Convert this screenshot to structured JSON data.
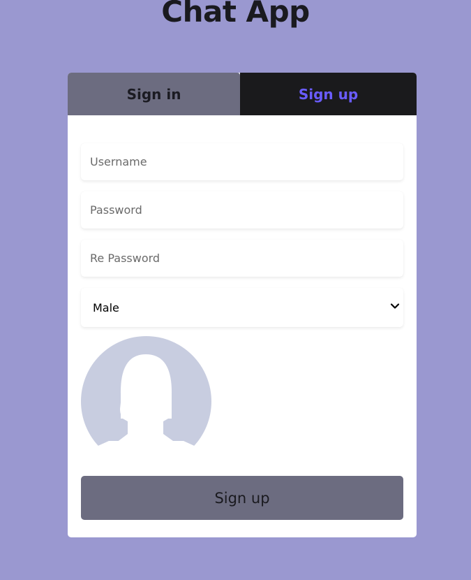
{
  "app": {
    "title": "Chat App"
  },
  "tabs": [
    {
      "label": "Sign in",
      "active": false
    },
    {
      "label": "Sign up",
      "active": true
    }
  ],
  "form": {
    "username": {
      "placeholder": "Username",
      "value": ""
    },
    "password": {
      "placeholder": "Password",
      "value": ""
    },
    "repassword": {
      "placeholder": "Re Password",
      "value": ""
    },
    "gender": {
      "selected": "Male"
    },
    "avatar": {
      "icon": "default-user-avatar-icon"
    },
    "submit_label": "Sign up"
  },
  "colors": {
    "background": "#9a98d0",
    "tab_inactive": "#6c6c80",
    "tab_active": "#1a1a1c",
    "tab_active_text": "#6a5cff",
    "button": "#6c6c80",
    "avatar_fill": "#c8cde0"
  }
}
